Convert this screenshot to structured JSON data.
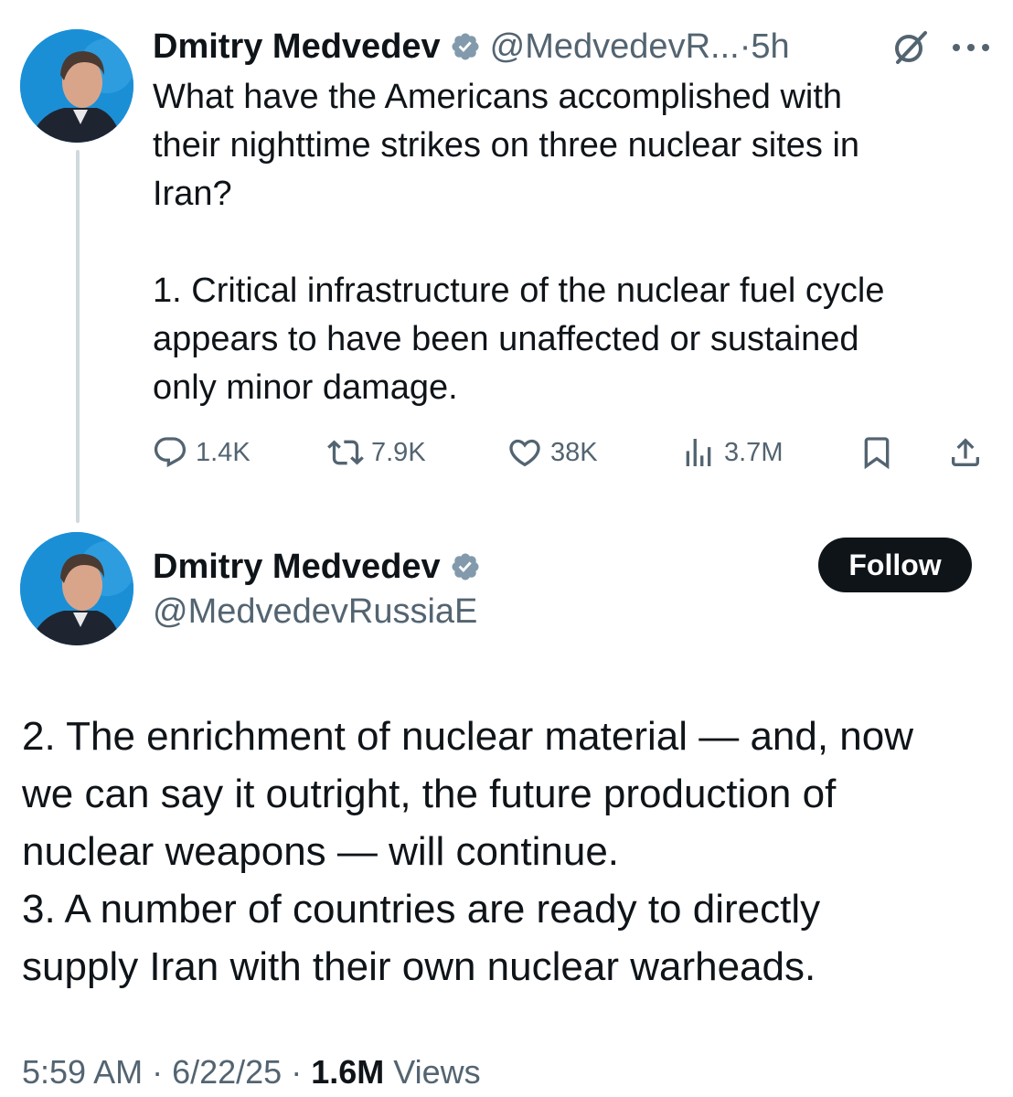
{
  "tweet1": {
    "author_name": "Dmitry Medvedev",
    "handle": "@MedvedevR...",
    "separator": " · ",
    "time": "5h",
    "body_lines": [
      "What have the Americans accomplished with",
      "their nighttime strikes on three nuclear sites in",
      "Iran?",
      "",
      "1. Critical infrastructure of the nuclear fuel cycle",
      "appears to have been unaffected or sustained",
      "only minor damage."
    ],
    "actions": {
      "replies": "1.4K",
      "reposts": "7.9K",
      "likes": "38K",
      "views": "3.7M"
    }
  },
  "tweet2": {
    "author_name": "Dmitry Medvedev",
    "handle": "@MedvedevRussiaE",
    "follow_label": "Follow",
    "body_lines": [
      "2. The enrichment of nuclear material — and, now",
      "we can say it outright, the future production of",
      "nuclear weapons — will continue.",
      "3. A number of countries are ready to directly",
      "supply Iran with their own nuclear warheads."
    ],
    "time": "5:59 AM",
    "date": "6/22/25",
    "separator": " · ",
    "views_count": "1.6M",
    "views_label": " Views"
  },
  "colors": {
    "text_primary": "#0f1419",
    "text_secondary": "#536471",
    "verified_badge": "#829aab",
    "thread_line": "#cfd9de",
    "follow_bg": "#0f1419",
    "avatar_bg": "#1d8fd8"
  },
  "icons": [
    "verified-badge-icon",
    "grok-icon",
    "more-icon",
    "reply-icon",
    "repost-icon",
    "like-icon",
    "views-icon",
    "bookmark-icon",
    "share-icon"
  ]
}
